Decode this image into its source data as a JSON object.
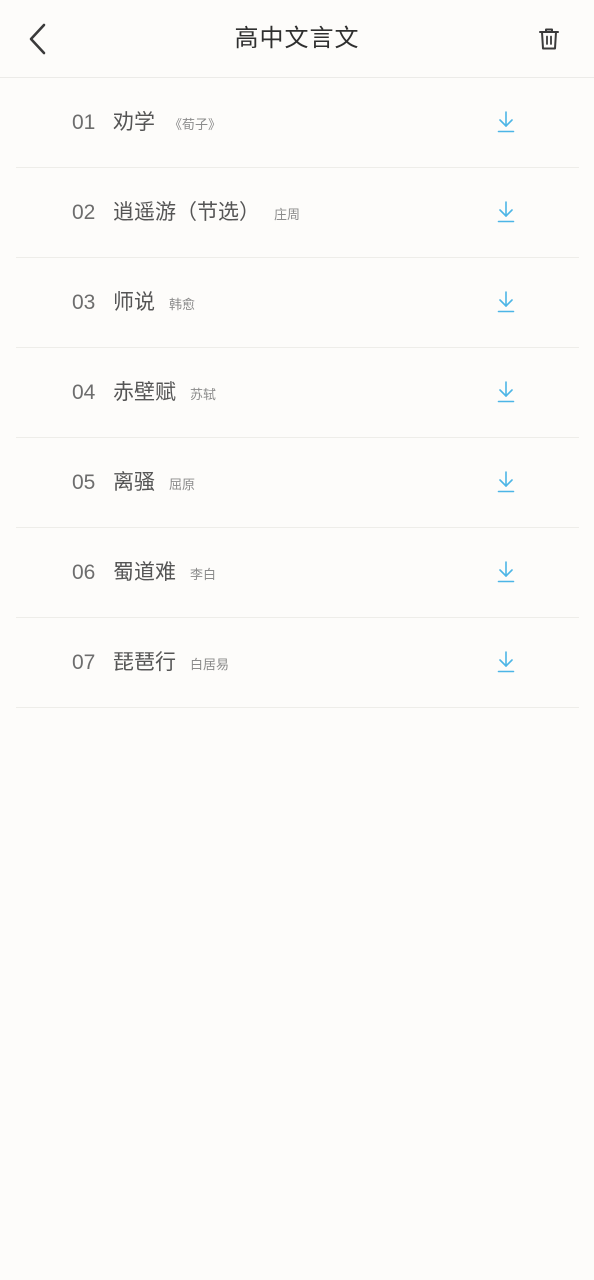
{
  "header": {
    "title": "高中文言文"
  },
  "items": [
    {
      "num": "01",
      "title": "劝学",
      "author": "《荀子》"
    },
    {
      "num": "02",
      "title": "逍遥游（节选）",
      "author": "庄周"
    },
    {
      "num": "03",
      "title": "师说",
      "author": "韩愈"
    },
    {
      "num": "04",
      "title": "赤壁赋",
      "author": "苏轼"
    },
    {
      "num": "05",
      "title": "离骚",
      "author": "屈原"
    },
    {
      "num": "06",
      "title": "蜀道难",
      "author": "李白"
    },
    {
      "num": "07",
      "title": "琵琶行",
      "author": "白居易"
    }
  ],
  "icons": {
    "back": "chevron-left-icon",
    "delete": "trash-icon",
    "download": "download-icon"
  },
  "colors": {
    "accent": "#4cb5e6",
    "background": "#fdfcfa",
    "divider": "#eeede9"
  }
}
